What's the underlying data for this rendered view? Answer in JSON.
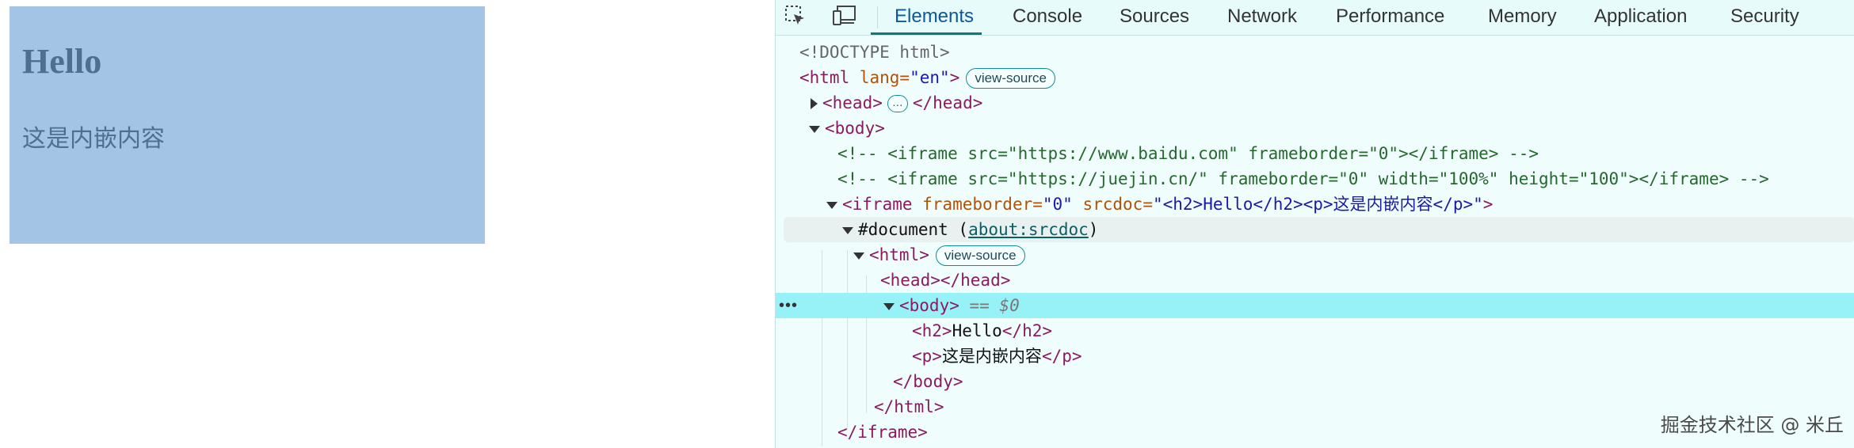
{
  "iframe": {
    "heading": "Hello",
    "paragraph": "这是内嵌内容"
  },
  "devtools": {
    "tabs": [
      "Elements",
      "Console",
      "Sources",
      "Network",
      "Performance",
      "Memory",
      "Application",
      "Security"
    ],
    "active_tab": "Elements",
    "view_source_label": "view-source",
    "ellipsis_label": "…",
    "row_dots": "•••",
    "lines": {
      "doctype": "<!DOCTYPE html>",
      "html_open": "<html",
      "html_lang_attr": " lang=",
      "html_lang_val": "\"en\"",
      "html_close_bracket": ">",
      "head_open": "<head>",
      "head_close": "</head>",
      "body_open": "<body>",
      "comment1": "<!-- <iframe src=\"https://www.baidu.com\" frameborder=\"0\"></iframe> -->",
      "comment2": "<!-- <iframe src=\"https://juejin.cn/\" frameborder=\"0\" width=\"100%\" height=\"100\"></iframe> -->",
      "iframe_open": "<iframe",
      "iframe_fb_attr": " frameborder=",
      "iframe_fb_val": "\"0\"",
      "iframe_srcdoc_attr": " srcdoc=",
      "iframe_srcdoc_val": "\"<h2>Hello</h2><p>这是内嵌内容</p>\"",
      "iframe_gt": ">",
      "document_label": "#document (",
      "document_link": "about:srcdoc",
      "document_close": ")",
      "inner_html_open": "<html>",
      "inner_head": "<head></head>",
      "inner_body_open": "<body>",
      "inner_body_eq": " == $0",
      "h2_open": "<h2>",
      "h2_text": "Hello",
      "h2_close": "</h2>",
      "p_open": "<p>",
      "p_text": "这是内嵌内容",
      "p_close": "</p>",
      "inner_body_close": "</body>",
      "inner_html_close": "</html>",
      "iframe_close": "</iframe>"
    }
  },
  "watermark": "掘金技术社区 @ 米丘"
}
